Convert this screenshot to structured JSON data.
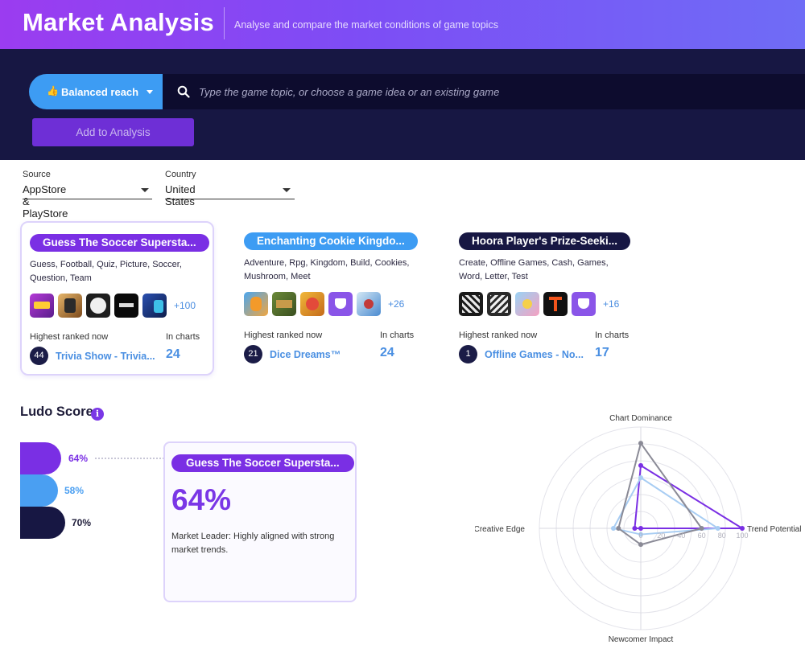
{
  "header": {
    "title": "Market Analysis",
    "subtitle": "Analyse and compare the market conditions of game topics"
  },
  "search": {
    "mode_emoji": "👍",
    "mode_label": "Balanced reach",
    "placeholder": "Type the game topic, or choose a game idea or an existing game",
    "add_button": "Add to Analysis"
  },
  "filters": {
    "source_label": "Source",
    "source_value": "AppStore & PlayStore",
    "country_label": "Country",
    "country_value": "United States"
  },
  "cards": [
    {
      "title": "Guess The Soccer Supersta...",
      "color": "#7a2fe4",
      "tags": "Guess, Football, Quiz, Picture, Soccer, Question, Team",
      "more": "+100",
      "highest_label": "Highest ranked now",
      "in_charts_label": "In charts",
      "rank": "44",
      "game": "Trivia Show - Trivia...",
      "in_charts": "24"
    },
    {
      "title": "Enchanting Cookie Kingdo...",
      "color": "#3d9cf3",
      "tags": "Adventure, Rpg, Kingdom, Build, Cookies, Mushroom, Meet",
      "more": "+26",
      "highest_label": "Highest ranked now",
      "in_charts_label": "In charts",
      "rank": "21",
      "game": "Dice Dreams™",
      "in_charts": "24"
    },
    {
      "title": "Hoora Player's Prize-Seeki...",
      "color": "#171743",
      "tags": "Create, Offline Games, Cash, Games, Word, Letter, Test",
      "more": "+16",
      "highest_label": "Highest ranked now",
      "in_charts_label": "In charts",
      "rank": "1",
      "game": "Offline Games - No...",
      "in_charts": "17"
    }
  ],
  "ludo": {
    "title": "Ludo Score",
    "info_icon": "i",
    "bars": [
      {
        "pct_label": "64%",
        "value": 64,
        "color": "#7a2fe4",
        "text_color": "#7a2fe4"
      },
      {
        "pct_label": "58%",
        "value": 58,
        "color": "#4a9ff2",
        "text_color": "#4a9ff2"
      },
      {
        "pct_label": "70%",
        "value": 70,
        "color": "#171743",
        "text_color": "#1f1d3a"
      }
    ],
    "detail": {
      "title": "Guess The Soccer Supersta...",
      "score": "64%",
      "description": "Market Leader: Highly aligned with strong market trends."
    }
  },
  "radar": {
    "axes": [
      "Chart Dominance",
      "Trend Potential",
      "Newcomer Impact",
      "Creative Edge"
    ],
    "ticks": [
      "0",
      "20",
      "40",
      "60",
      "80",
      "100"
    ],
    "max": 100,
    "series": [
      {
        "color": "#7a2fe4",
        "values": [
          62,
          100,
          0,
          6
        ]
      },
      {
        "color": "#a8cdf3",
        "values": [
          50,
          76,
          6,
          27
        ]
      },
      {
        "color": "#8a8a96",
        "values": [
          84,
          60,
          16,
          22
        ]
      }
    ]
  }
}
